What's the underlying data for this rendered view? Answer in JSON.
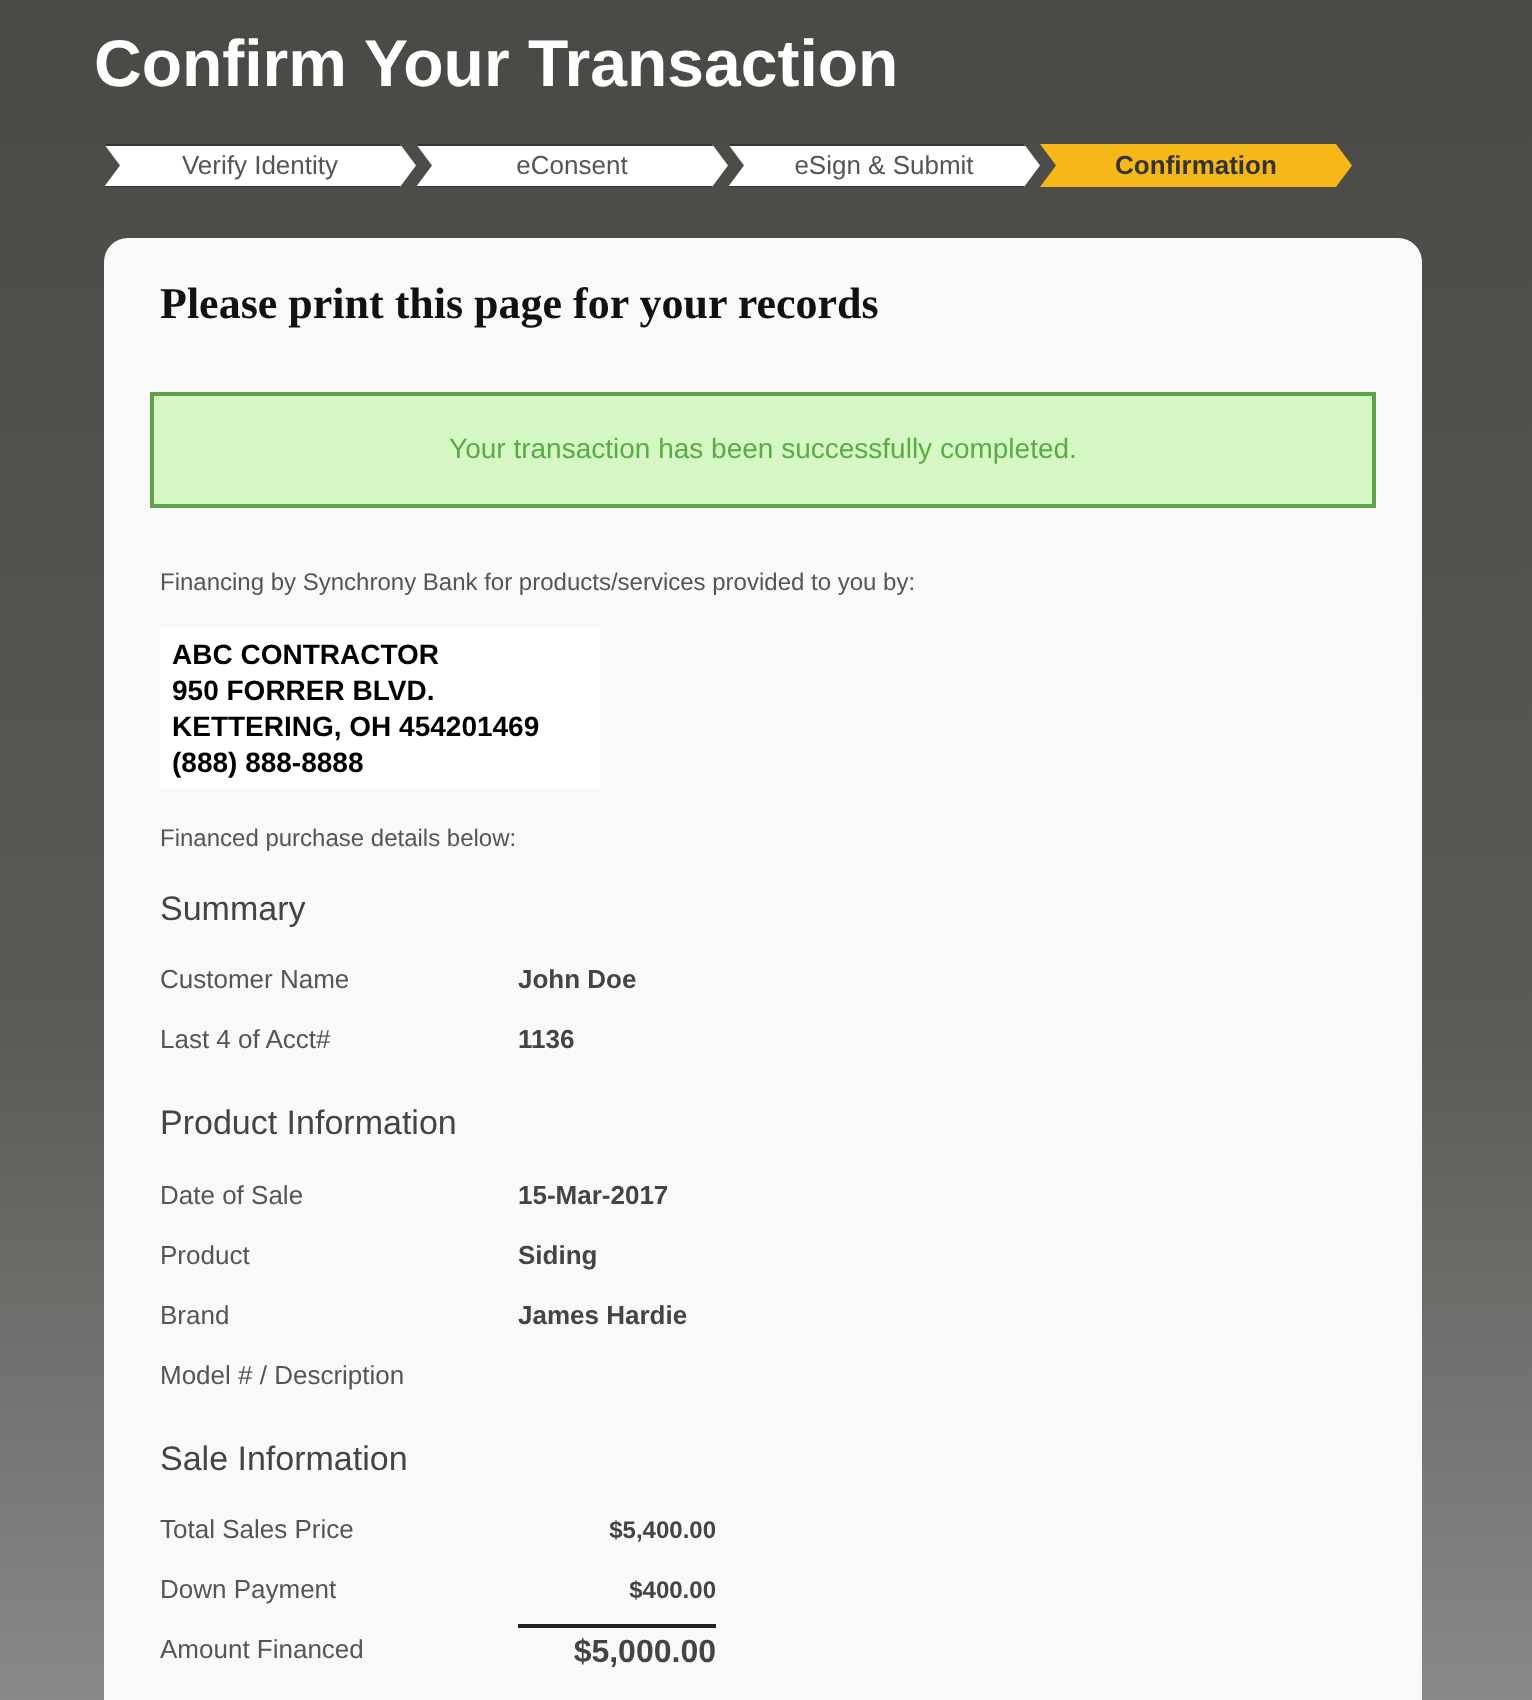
{
  "page_title": "Confirm Your Transaction",
  "steps": [
    {
      "label": "Verify Identity",
      "selected": false
    },
    {
      "label": "eConsent",
      "selected": false
    },
    {
      "label": "eSign & Submit",
      "selected": false
    },
    {
      "label": "Confirmation",
      "selected": true
    }
  ],
  "card": {
    "heading": "Please print this page for your records",
    "success_message": "Your transaction has been successfully completed.",
    "financing_note": "Financing by Synchrony Bank for products/services provided to you by:",
    "merchant_address": [
      "ABC CONTRACTOR",
      "950 FORRER BLVD.",
      "KETTERING, OH 454201469",
      "(888) 888-8888"
    ],
    "details_note": "Financed purchase details below:",
    "sections": [
      {
        "title": "Summary",
        "kind": "details",
        "rows": [
          {
            "label": "Customer Name",
            "value": "John Doe"
          },
          {
            "label": "Last 4 of Acct#",
            "value": "1136"
          }
        ]
      },
      {
        "title": "Product Information",
        "kind": "details",
        "rows": [
          {
            "label": "Date of Sale",
            "value": "15-Mar-2017"
          },
          {
            "label": "Product",
            "value": "Siding"
          },
          {
            "label": "Brand",
            "value": "James Hardie"
          },
          {
            "label": "Model # / Description"
          }
        ]
      },
      {
        "title": "Sale Information",
        "kind": "amounts",
        "rows": [
          {
            "label": "Total Sales Price",
            "value": "$5,400.00",
            "kind": "line"
          },
          {
            "label": "Down Payment",
            "value": "$400.00",
            "kind": "line"
          },
          {
            "label": "Amount Financed",
            "value": "$5,000.00",
            "kind": "total"
          }
        ]
      }
    ]
  }
}
